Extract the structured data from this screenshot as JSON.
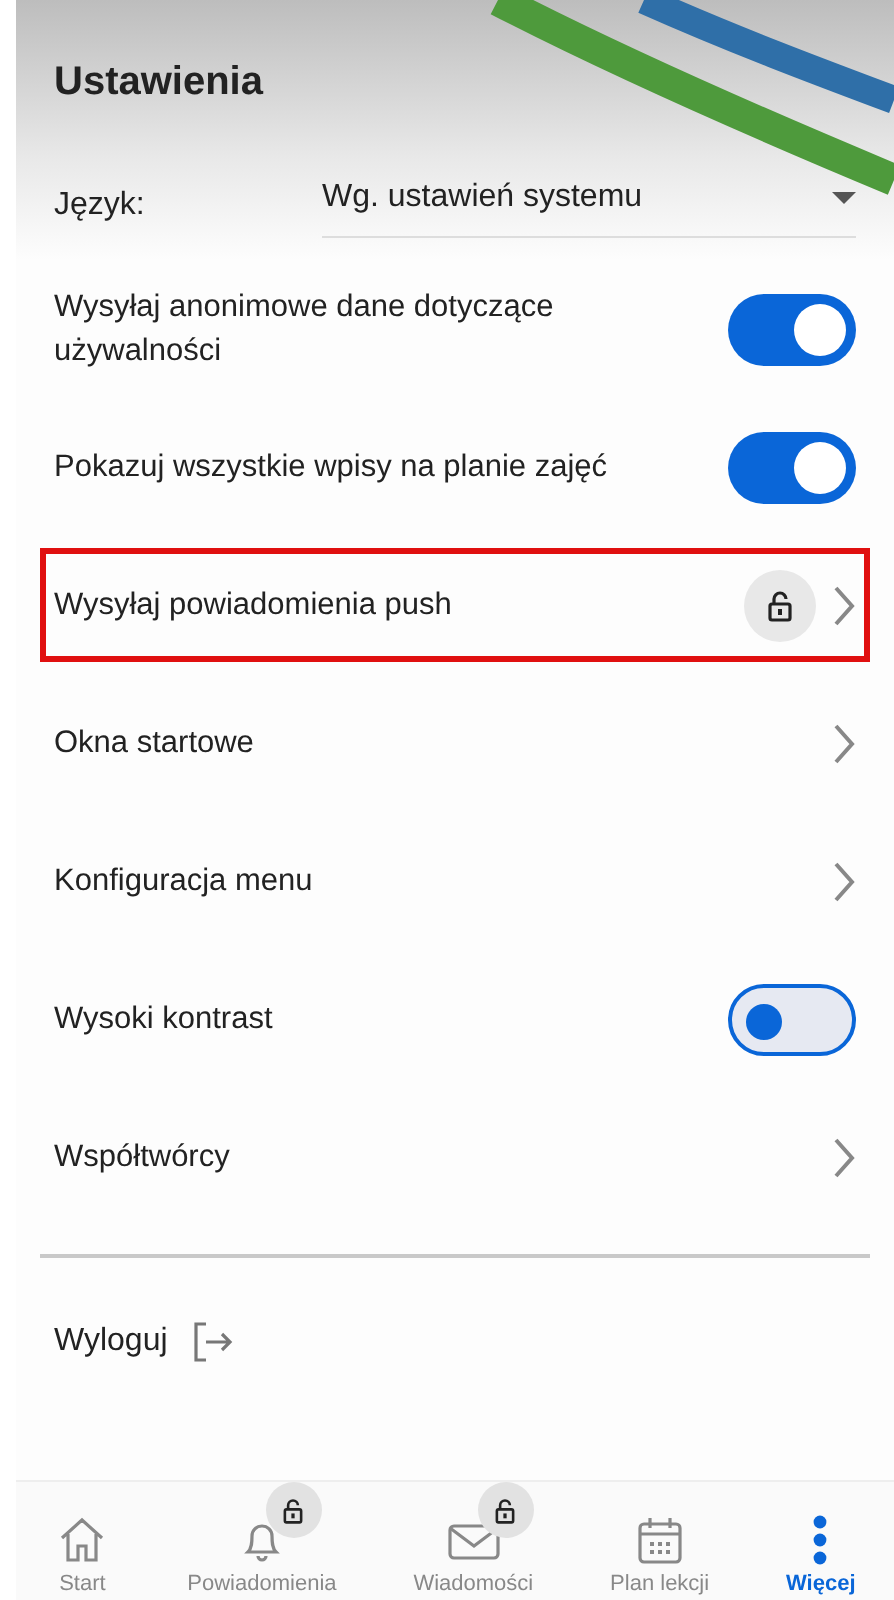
{
  "header": {
    "title": "Ustawienia"
  },
  "language": {
    "label": "Język:",
    "value": "Wg. ustawień systemu"
  },
  "settings": [
    {
      "kind": "toggle",
      "label": "Wysyłaj anonimowe dane dotyczące używalności",
      "on": true,
      "highlighted": false
    },
    {
      "kind": "toggle",
      "label": "Pokazuj wszystkie wpisy na planie zajęć",
      "on": true,
      "highlighted": false
    },
    {
      "kind": "link",
      "label": "Wysyłaj powiadomienia push",
      "highlighted": true,
      "locked": true
    },
    {
      "kind": "link",
      "label": "Okna startowe",
      "highlighted": false,
      "locked": false
    },
    {
      "kind": "link",
      "label": "Konfiguracja menu",
      "highlighted": false,
      "locked": false
    },
    {
      "kind": "toggle",
      "label": "Wysoki kontrast",
      "on": false,
      "highlighted": false
    },
    {
      "kind": "link",
      "label": "Współtwórcy",
      "highlighted": false,
      "locked": false
    }
  ],
  "logout": {
    "label": "Wyloguj"
  },
  "nav": [
    {
      "kind": "home",
      "label": "Start",
      "selected": false,
      "locked": false
    },
    {
      "kind": "bell",
      "label": "Powiadomienia",
      "selected": false,
      "locked": true
    },
    {
      "kind": "mail",
      "label": "Wiadomości",
      "selected": false,
      "locked": true
    },
    {
      "kind": "calendar",
      "label": "Plan lekcji",
      "selected": false,
      "locked": false
    },
    {
      "kind": "more",
      "label": "Więcej",
      "selected": true,
      "locked": false
    }
  ]
}
